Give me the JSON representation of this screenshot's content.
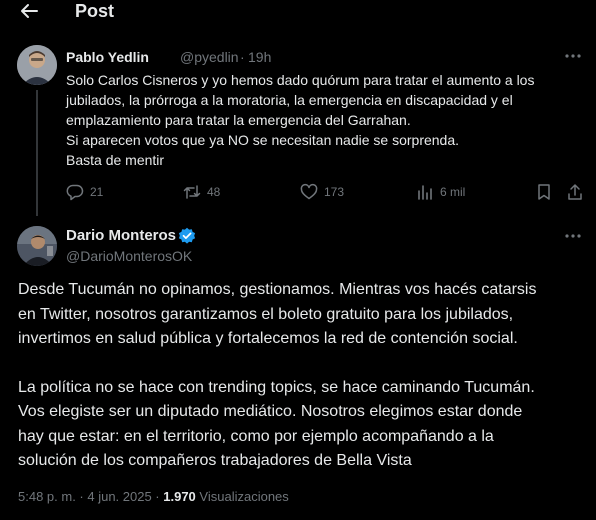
{
  "header": {
    "title": "Post"
  },
  "quoted_tweet": {
    "author_name": "Pablo Yedlin",
    "handle": "@pyedlin",
    "separator": "·",
    "time": "19h",
    "lines": [
      "Solo Carlos Cisneros y yo hemos dado quórum para tratar el aumento a los",
      "jubilados, la prórroga a la moratoria, la emergencia en discapacidad y el",
      "emplazamiento para tratar la emergencia del Garrahan.",
      "Si aparecen votos que ya NO se necesitan nadie se sorprenda.",
      "Basta de mentir"
    ],
    "actions": {
      "replies": "21",
      "retweets": "48",
      "likes": "173",
      "views": "6 mil"
    }
  },
  "main_tweet": {
    "author_name": "Dario Monteros",
    "handle": "@DarioMonterosOK",
    "paragraph1": [
      "Desde Tucumán no opinamos, gestionamos. Mientras vos hacés catarsis",
      "en Twitter, nosotros garantizamos el boleto gratuito para los jubilados,",
      "invertimos en salud pública y fortalecemos la red de contención social."
    ],
    "paragraph2": [
      "La política no se hace con trending topics, se hace caminando Tucumán.",
      "Vos elegiste ser un diputado mediático. Nosotros elegimos estar donde",
      "hay que estar: en el territorio, como por ejemplo acompañando a la",
      "solución de los compañeros trabajadores de Bella Vista"
    ],
    "timestamp": "5:48 p. m. · 4 jun. 2025 · ",
    "views_count": "1.970",
    "views_label": " Visualizaciones"
  },
  "colors": {
    "background": "#000000",
    "text": "#e7e9ea",
    "muted": "#71767b",
    "verified": "#1d9bf0"
  },
  "icons": [
    "back-arrow-icon",
    "more-icon",
    "reply-icon",
    "retweet-icon",
    "like-icon",
    "views-icon",
    "bookmark-icon",
    "share-icon",
    "verified-badge-icon"
  ]
}
